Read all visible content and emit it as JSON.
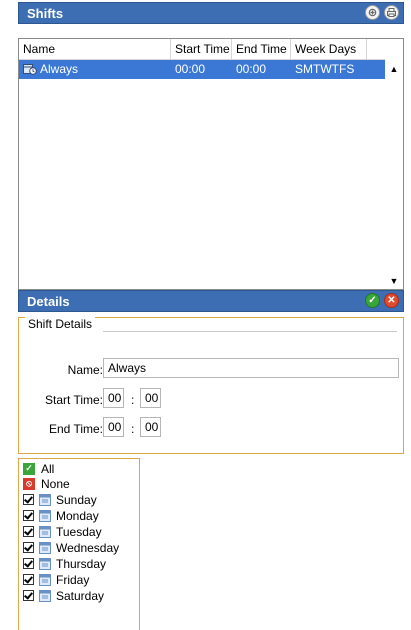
{
  "shifts": {
    "title": "Shifts",
    "columns": [
      "Name",
      "Start Time",
      "End Time",
      "Week Days"
    ],
    "rows": [
      {
        "name": "Always",
        "start": "00:00",
        "end": "00:00",
        "days": "SMTWTFS",
        "selected": true
      }
    ],
    "header_icons": [
      "add-shift-icon",
      "print-icon"
    ]
  },
  "details": {
    "title": "Details",
    "header_icons": [
      "save-icon",
      "cancel-icon"
    ],
    "group_label": "Shift Details",
    "name_label": "Name:",
    "name_value": "Always",
    "start_label": "Start Time:",
    "start_hour": "00",
    "start_minute": "00",
    "end_label": "End Time:",
    "end_hour": "00",
    "end_minute": "00",
    "separator": ":"
  },
  "days": {
    "all_label": "All",
    "none_label": "None",
    "items": [
      {
        "label": "Sunday",
        "checked": true
      },
      {
        "label": "Monday",
        "checked": true
      },
      {
        "label": "Tuesday",
        "checked": true
      },
      {
        "label": "Wednesday",
        "checked": true
      },
      {
        "label": "Thursday",
        "checked": true
      },
      {
        "label": "Friday",
        "checked": true
      },
      {
        "label": "Saturday",
        "checked": true
      }
    ]
  },
  "colors": {
    "header_bg": "#3d6db2",
    "selection_bg": "#3b78d6",
    "group_border": "#e1a64a"
  }
}
